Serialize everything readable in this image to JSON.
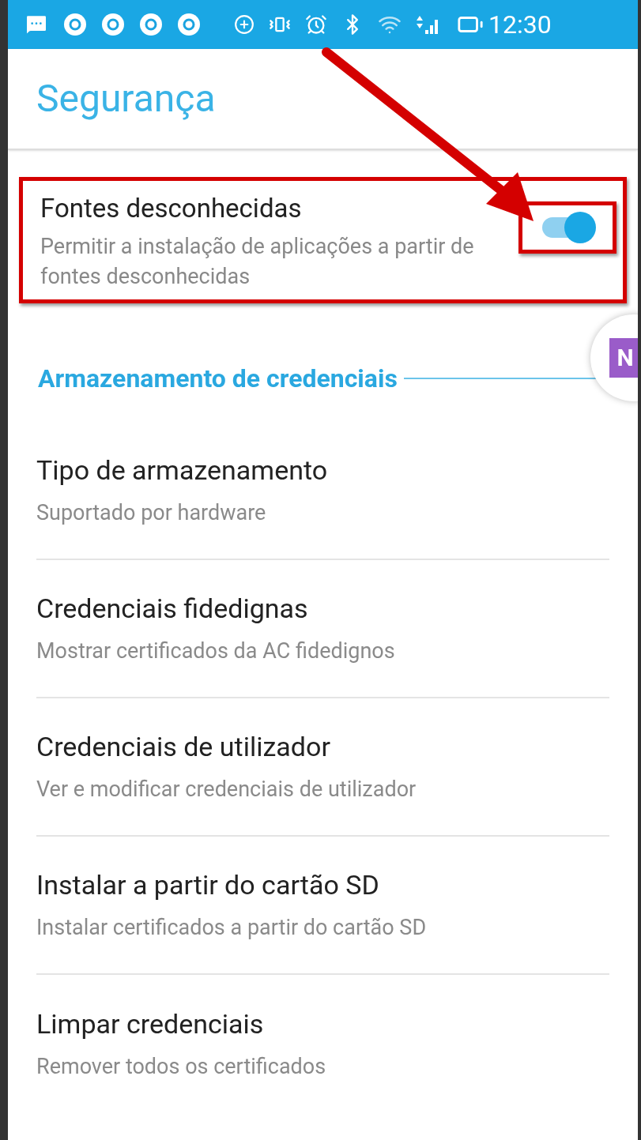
{
  "status_bar": {
    "time": "12:30"
  },
  "title": "Segurança",
  "unknown_sources": {
    "title": "Fontes desconhecidas",
    "subtitle": "Permitir a instalação de aplicações a partir de fontes desconhecidas",
    "on": true
  },
  "floating_bubble": {
    "letter": "N"
  },
  "section": {
    "title": "Armazenamento de credenciais"
  },
  "items": [
    {
      "title": "Tipo de armazenamento",
      "subtitle": "Suportado por hardware"
    },
    {
      "title": "Credenciais fidedignas",
      "subtitle": "Mostrar certificados da AC fidedignos"
    },
    {
      "title": "Credenciais de utilizador",
      "subtitle": "Ver e modificar credenciais de utilizador"
    },
    {
      "title": "Instalar a partir do cartão SD",
      "subtitle": "Instalar certificados a partir do cartão SD"
    },
    {
      "title": "Limpar credenciais",
      "subtitle": "Remover todos os certificados"
    }
  ]
}
